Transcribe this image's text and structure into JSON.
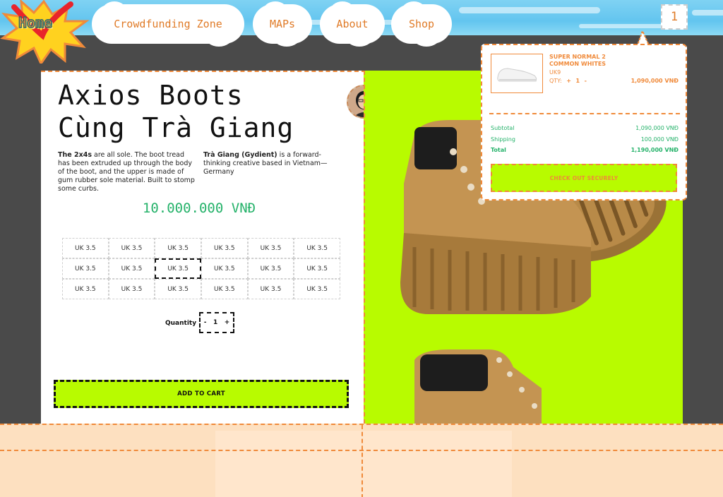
{
  "nav": {
    "home": "Home",
    "items": [
      {
        "label": "Crowdfunding Zone"
      },
      {
        "label": "MAPs"
      },
      {
        "label": "About"
      },
      {
        "label": "Shop"
      }
    ],
    "cart_count": "1"
  },
  "product": {
    "title_line1": "Axios Boots",
    "title_line2": "Cùng Trà Giang",
    "desc_left_bold": "The 2x4s",
    "desc_left_rest": " are all sole. The boot tread has been extruded up through the body of the boot, and the upper is made of gum rubber sole material. Built to stomp some curbs.",
    "desc_right_bold": "Trà Giang (Gydient)",
    "desc_right_rest": " is a forward-thinking creative based in Vietnam—Germany",
    "price": "10.000.000 VNĐ",
    "sizes": [
      "UK 3.5",
      "UK 3.5",
      "UK 3.5",
      "UK 3.5",
      "UK 3.5",
      "UK 3.5",
      "UK 3.5",
      "UK 3.5",
      "UK 3.5",
      "UK 3.5",
      "UK 3.5",
      "UK 3.5",
      "UK 3.5",
      "UK 3.5",
      "UK 3.5",
      "UK 3.5",
      "UK 3.5",
      "UK 3.5"
    ],
    "selected_size_index": 8,
    "quantity_label": "Quantity",
    "quantity_minus": "-",
    "quantity_value": "1",
    "quantity_plus": "+",
    "add_to_cart": "ADD TO CART"
  },
  "cart": {
    "item_name": "SUPER NORMAL 2 COMMON WHITES",
    "item_size": "UK9",
    "qty_label": "QTY:",
    "qty_plus": "+",
    "qty_value": "1",
    "qty_minus": "-",
    "item_price": "1,090,000 VNĐ",
    "subtotal_label": "Subtotal",
    "subtotal_value": "1,090,000 VNĐ",
    "shipping_label": "Shipping",
    "shipping_value": "100,000 VNĐ",
    "total_label": "Total",
    "total_value": "1,190,000 VNĐ",
    "checkout": "CHECK OUT SECURELY"
  },
  "colors": {
    "accent_orange": "#f08a3a",
    "lime": "#b8fb00",
    "price_green": "#25b26a",
    "sky_blue": "#63c5ef"
  }
}
